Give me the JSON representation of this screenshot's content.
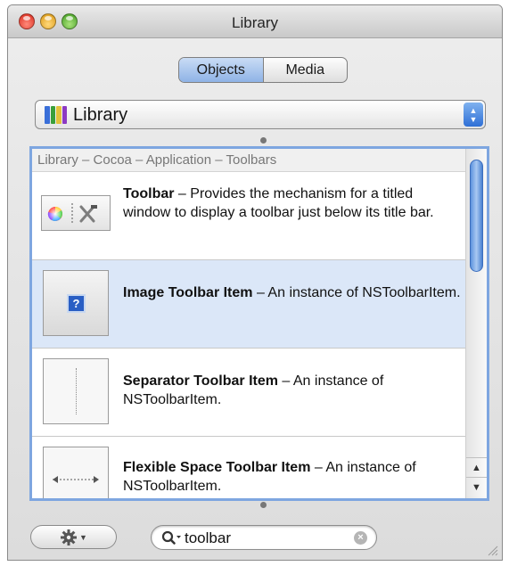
{
  "window": {
    "title": "Library"
  },
  "segmented": {
    "objects_label": "Objects",
    "media_label": "Media",
    "selected": "Objects"
  },
  "popup": {
    "label": "Library",
    "icon_colors": [
      "#3a6fd8",
      "#3a9f3a",
      "#e2c23a",
      "#8c3ac2"
    ]
  },
  "breadcrumb": {
    "text": "Library – Cocoa – Application – Toolbars"
  },
  "items": [
    {
      "title": "Toolbar",
      "description": " – Provides the mechanism for a titled window to display a toolbar just below its title bar.",
      "selected": false,
      "icon": "toolbar-icon"
    },
    {
      "title": "Image Toolbar Item",
      "description": " – An instance of NSToolbarItem.",
      "selected": true,
      "icon": "image-toolbar-item-icon",
      "glyph": "?"
    },
    {
      "title": "Separator Toolbar Item",
      "description": " – An instance of NSToolbarItem.",
      "selected": false,
      "icon": "separator-toolbar-item-icon"
    },
    {
      "title": "Flexible Space Toolbar Item",
      "description": " – An instance of NSToolbarItem.",
      "selected": false,
      "icon": "flexible-space-toolbar-item-icon"
    }
  ],
  "search": {
    "value": "toolbar",
    "clear_glyph": "×"
  },
  "colors": {
    "selection": "#dbe7f8",
    "accent": "#7ea6e0",
    "scroll_thumb": "#5c93de"
  }
}
